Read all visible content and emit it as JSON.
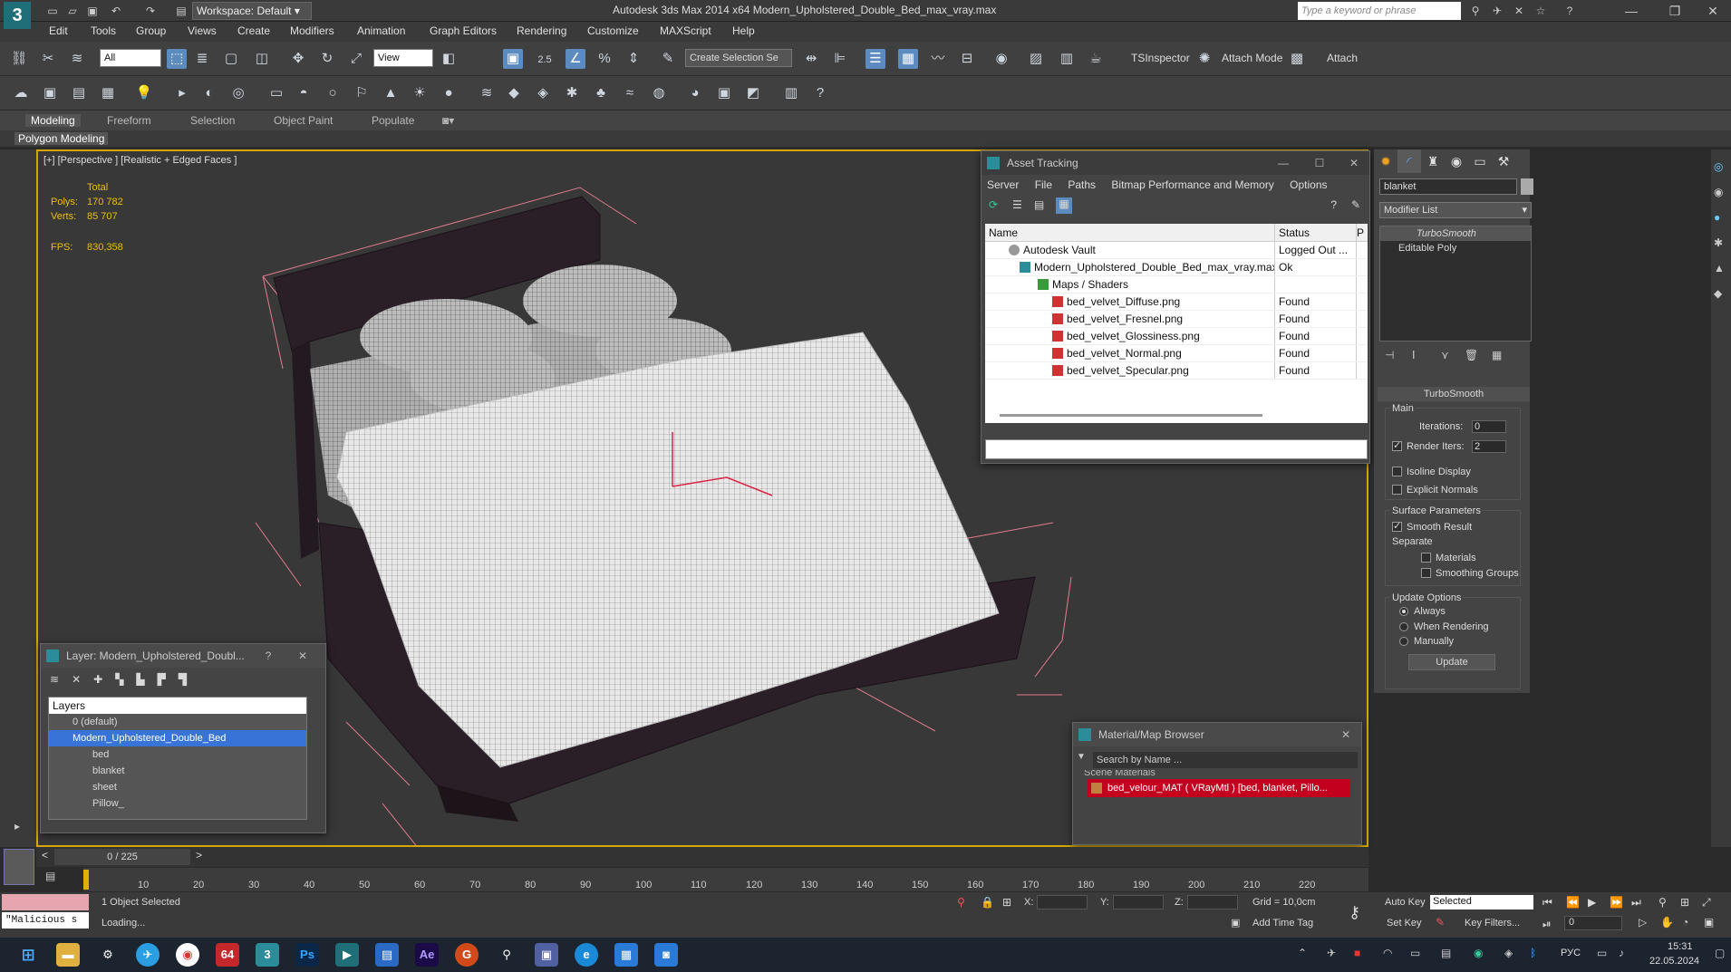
{
  "app": {
    "logo": "3",
    "workspace": "Workspace: Default",
    "title": "Autodesk 3ds Max 2014 x64    Modern_Upholstered_Double_Bed_max_vray.max",
    "search_placeholder": "Type a keyword or phrase"
  },
  "menus": [
    "Edit",
    "Tools",
    "Group",
    "Views",
    "Create",
    "Modifiers",
    "Animation",
    "Graph Editors",
    "Rendering",
    "Customize",
    "MAXScript",
    "Help"
  ],
  "toolbar": {
    "filter_value": "All",
    "ref_coord_value": "View",
    "selection_set_placeholder": "Create Selection Se",
    "snap_label": "2.5",
    "tsinspector": "TSInspector",
    "attach_mode": "Attach Mode",
    "attach": "Attach"
  },
  "ribbon": {
    "tabs": [
      "Modeling",
      "Freeform",
      "Selection",
      "Object Paint",
      "Populate"
    ],
    "active_tab": "Modeling",
    "sub": "Polygon Modeling"
  },
  "viewport": {
    "label": "[+] [Perspective ] [Realistic + Edged Faces ]",
    "stats_total": "Total",
    "polys_label": "Polys:",
    "polys_value": "170 782",
    "verts_label": "Verts:",
    "verts_value": "85 707",
    "fps_label": "FPS:",
    "fps_value": "830,358"
  },
  "asset_tracking": {
    "title": "Asset Tracking",
    "menu": [
      "Server",
      "File",
      "Paths",
      "Bitmap Performance and Memory",
      "Options"
    ],
    "col_name": "Name",
    "col_status": "Status",
    "col_extra": "P",
    "rows": [
      {
        "name": "Autodesk Vault",
        "status": "Logged Out ...",
        "indent": "0"
      },
      {
        "name": "Modern_Upholstered_Double_Bed_max_vray.max",
        "status": "Ok",
        "indent": "1"
      },
      {
        "name": "Maps / Shaders",
        "status": "",
        "indent": "2"
      },
      {
        "name": "bed_velvet_Diffuse.png",
        "status": "Found",
        "indent": "3"
      },
      {
        "name": "bed_velvet_Fresnel.png",
        "status": "Found",
        "indent": "3"
      },
      {
        "name": "bed_velvet_Glossiness.png",
        "status": "Found",
        "indent": "3"
      },
      {
        "name": "bed_velvet_Normal.png",
        "status": "Found",
        "indent": "3"
      },
      {
        "name": "bed_velvet_Specular.png",
        "status": "Found",
        "indent": "3"
      }
    ]
  },
  "command_panel": {
    "object_name": "blanket",
    "modifier_list": "Modifier List",
    "stack": [
      "TurboSmooth",
      "Editable Poly"
    ],
    "rollout_title": "TurboSmooth",
    "main_group": "Main",
    "iterations_label": "Iterations:",
    "iterations_value": "0",
    "render_iters_label": "Render Iters:",
    "render_iters_value": "2",
    "isoline": "Isoline Display",
    "explicit_normals": "Explicit Normals",
    "surface_params": "Surface Parameters",
    "smooth_result": "Smooth Result",
    "separate": "Separate",
    "materials": "Materials",
    "smoothing_groups": "Smoothing Groups",
    "update_options": "Update Options",
    "always": "Always",
    "when_rendering": "When Rendering",
    "manually": "Manually",
    "update_button": "Update"
  },
  "layer_window": {
    "title": "Layer: Modern_Upholstered_Doubl...",
    "help": "?",
    "header": "Layers",
    "items": [
      "0 (default)",
      "Modern_Upholstered_Double_Bed",
      "bed",
      "blanket",
      "sheet",
      "Pillow_"
    ]
  },
  "material_browser": {
    "title": "Material/Map Browser",
    "search_placeholder": "Search by Name ...",
    "section": "Scene Materials",
    "item": "bed_velour_MAT ( VRayMtl ) [bed, blanket, Pillo..."
  },
  "timeline": {
    "frame": "0 / 225",
    "ticks": [
      "10",
      "20",
      "30",
      "40",
      "50",
      "60",
      "70",
      "80",
      "90",
      "100",
      "110",
      "120",
      "130",
      "140",
      "150",
      "160",
      "170",
      "180",
      "190",
      "200",
      "210",
      "220"
    ]
  },
  "status": {
    "maxscript": "\"Malicious s",
    "selected": "1 Object Selected",
    "loading": "Loading...",
    "x_label": "X:",
    "y_label": "Y:",
    "z_label": "Z:",
    "grid": "Grid = 10,0cm",
    "add_time_tag": "Add Time Tag",
    "auto_key": "Auto Key",
    "set_key": "Set Key",
    "key_mode": "Selected",
    "key_filters": "Key Filters...",
    "frame_value": "0"
  },
  "taskbar": {
    "lang": "РУС",
    "time": "15:31",
    "date": "22.05.2024",
    "badge": "64"
  }
}
